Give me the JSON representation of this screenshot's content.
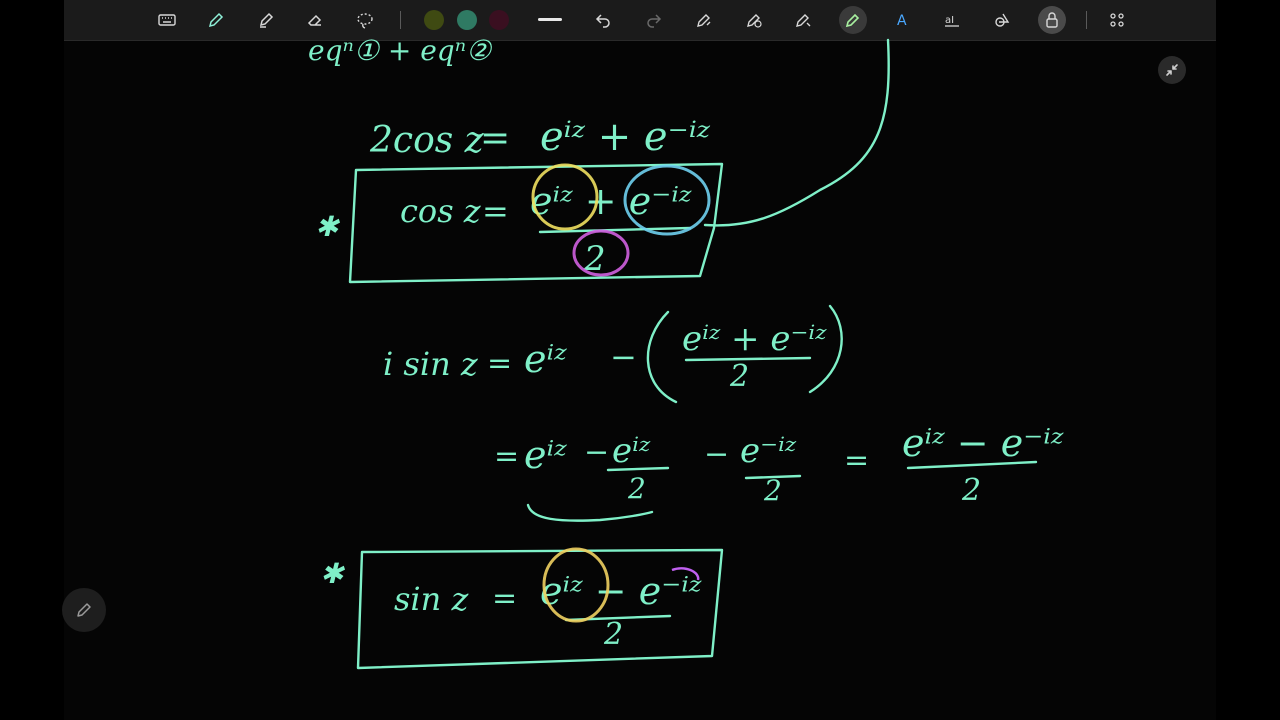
{
  "toolbar": {
    "tools": [
      {
        "name": "keyboard-icon",
        "label": "Keyboard"
      },
      {
        "name": "pen-icon",
        "label": "Pen"
      },
      {
        "name": "highlighter-icon",
        "label": "Highlighter"
      },
      {
        "name": "eraser-icon",
        "label": "Eraser"
      },
      {
        "name": "lasso-icon",
        "label": "Lasso"
      },
      {
        "name": "undo-icon",
        "label": "Undo"
      },
      {
        "name": "redo-icon",
        "label": "Redo"
      },
      {
        "name": "shape-pen-icon",
        "label": "Shape pen"
      },
      {
        "name": "add-pen-icon",
        "label": "Add pen"
      },
      {
        "name": "pointer-pen-icon",
        "label": "Pointer pen"
      },
      {
        "name": "rainbow-pen-icon",
        "label": "Rainbow pen"
      },
      {
        "name": "text-style-icon",
        "label": "Text style"
      },
      {
        "name": "text-box-icon",
        "label": "Text box"
      },
      {
        "name": "shapes-icon",
        "label": "Shapes"
      },
      {
        "name": "lock-icon",
        "label": "Lock"
      },
      {
        "name": "more-tools-icon",
        "label": "More"
      }
    ],
    "colors": [
      "#3f4a12",
      "#2f7a63",
      "#3a0f20"
    ],
    "stroke_color": "#e8e8e8",
    "active_tool": "rainbow-pen-icon"
  },
  "accent": "#7ff0c8",
  "handwriting": {
    "top_fragment": "eqⁿ① + eqⁿ②",
    "line1": {
      "lhs": "2cos z",
      "eq": "=",
      "rhs": "eⁱᶻ + e⁻ⁱᶻ"
    },
    "box1": {
      "lhs": "cos z",
      "eq": "=",
      "num": "eⁱᶻ + e⁻ⁱᶻ",
      "den": "2"
    },
    "line2": {
      "lhs": "i sin z",
      "eq": "=",
      "t1": "eⁱᶻ",
      "minus": "−",
      "num": "eⁱᶻ + e⁻ⁱᶻ",
      "den": "2"
    },
    "line3": {
      "eq": "=",
      "t1": "eⁱᶻ",
      "t2": "eⁱᶻ",
      "t2den": "2",
      "t3": "e⁻ⁱᶻ",
      "t3den": "2",
      "eq2": "=",
      "resnum": "eⁱᶻ − e⁻ⁱᶻ",
      "resden": "2"
    },
    "box2": {
      "lhs": "sin z",
      "eq": "=",
      "num": "eⁱᶻ − e⁻ⁱᶻ",
      "den": "2"
    },
    "star": "✱"
  }
}
